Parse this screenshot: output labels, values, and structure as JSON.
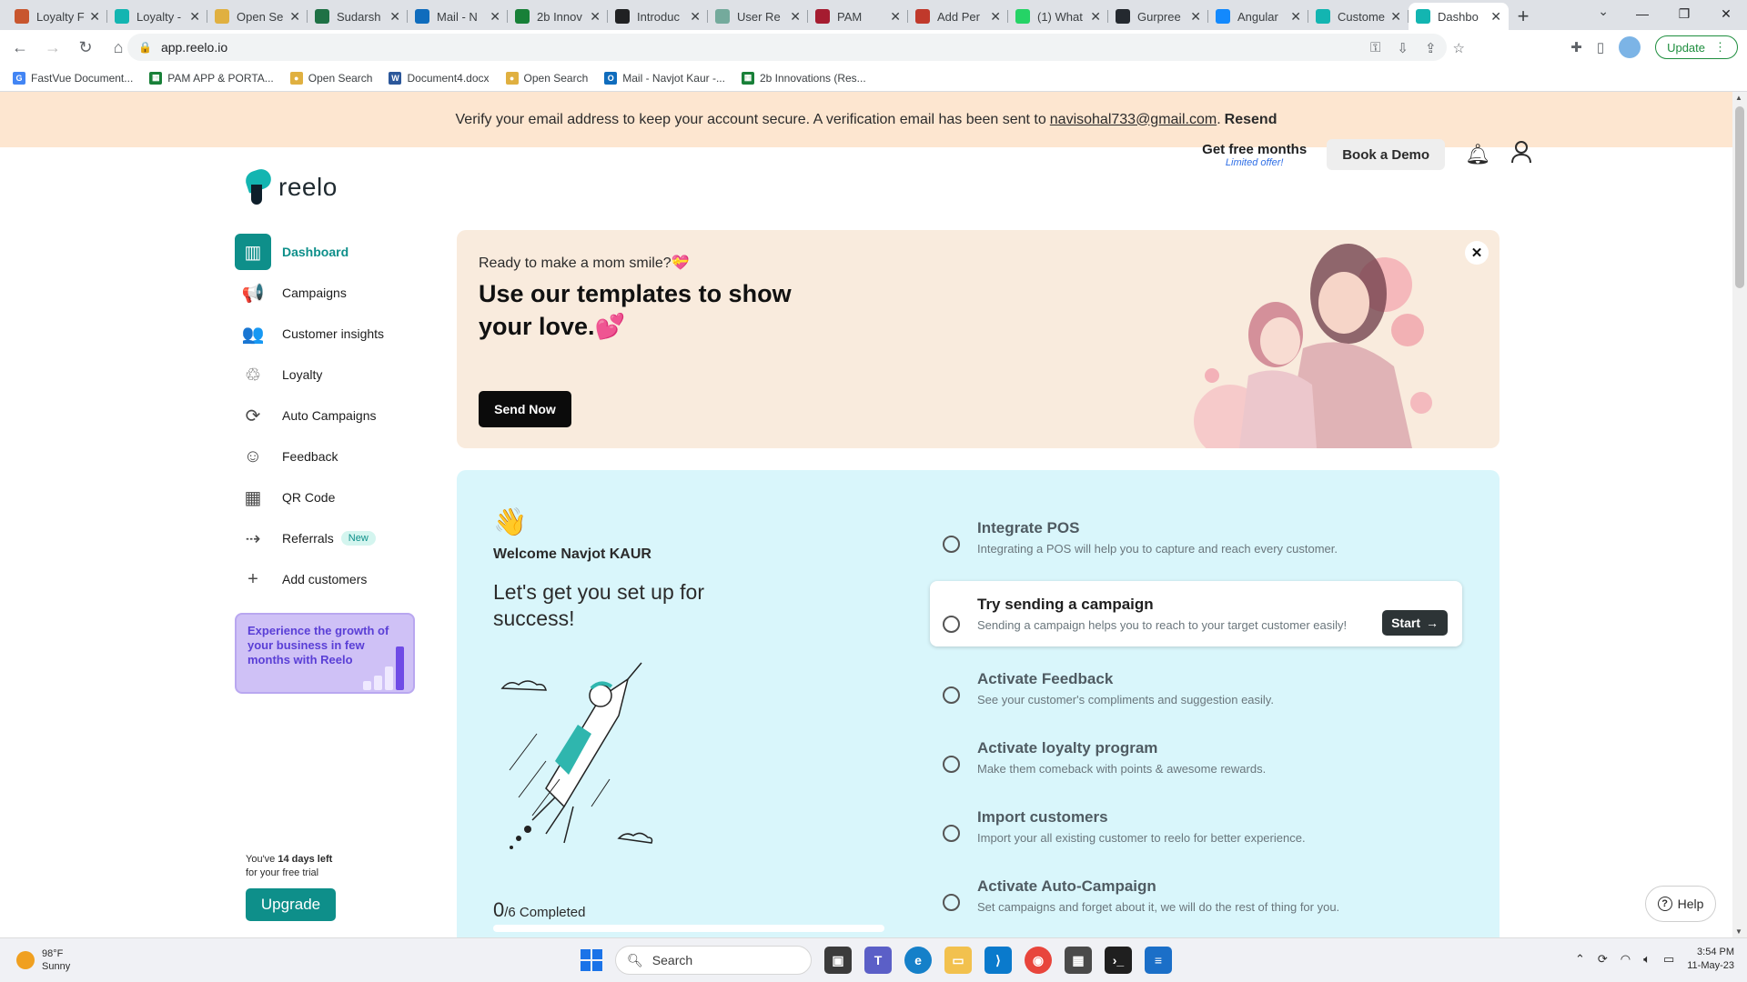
{
  "browser": {
    "tabs": [
      {
        "title": "Loyalty F",
        "icon": "tab-b-icon",
        "color": "#c8562e"
      },
      {
        "title": "Loyalty -",
        "icon": "reelo-icon",
        "color": "#13b5b1"
      },
      {
        "title": "Open Se",
        "icon": "opensearch-icon",
        "color": "#e0b040"
      },
      {
        "title": "Sudarsh",
        "icon": "excel-icon",
        "color": "#1e7145"
      },
      {
        "title": "Mail - N",
        "icon": "outlook-icon",
        "color": "#0f6cbd"
      },
      {
        "title": "2b Innov",
        "icon": "sheets-icon",
        "color": "#188038"
      },
      {
        "title": "Introduc",
        "icon": "openai-icon",
        "color": "#202123"
      },
      {
        "title": "User Re",
        "icon": "chatgpt-icon",
        "color": "#74aa9c"
      },
      {
        "title": "PAM",
        "icon": "pam-icon",
        "color": "#a51c30"
      },
      {
        "title": "Add Per",
        "icon": "p-icon",
        "color": "#c0392b"
      },
      {
        "title": "(1) What",
        "icon": "whatsapp-icon",
        "color": "#25d366"
      },
      {
        "title": "Gurpree",
        "icon": "github-icon",
        "color": "#24292f"
      },
      {
        "title": "Angular",
        "icon": "stackblitz-icon",
        "color": "#1389fd"
      },
      {
        "title": "Custome",
        "icon": "reelo-icon",
        "color": "#13b5b1"
      },
      {
        "title": "Dashbo",
        "icon": "reelo-icon",
        "color": "#13b5b1",
        "active": true
      }
    ],
    "new_tab": "+",
    "url": "app.reelo.io",
    "update_label": "Update",
    "bookmarks": [
      {
        "label": "FastVue Document...",
        "color": "#4285f4",
        "glyph": "G"
      },
      {
        "label": "PAM APP & PORTA...",
        "color": "#188038",
        "glyph": "▦"
      },
      {
        "label": "Open Search",
        "color": "#e0b040",
        "glyph": "●"
      },
      {
        "label": "Document4.docx",
        "color": "#2b579a",
        "glyph": "W"
      },
      {
        "label": "Open Search",
        "color": "#e0b040",
        "glyph": "●"
      },
      {
        "label": "Mail - Navjot Kaur -...",
        "color": "#0f6cbd",
        "glyph": "O"
      },
      {
        "label": "2b Innovations (Res...",
        "color": "#188038",
        "glyph": "▦"
      }
    ]
  },
  "banner": {
    "text": "Verify your email address to keep your account secure. A verification email has been sent to",
    "email": "navisohal733@gmail.com",
    "period": ".",
    "resend": "Resend"
  },
  "header": {
    "logo_text": "reelo",
    "free_months": "Get free months",
    "limited": "Limited offer!",
    "book_demo": "Book a Demo"
  },
  "sidebar": {
    "items": [
      {
        "label": "Dashboard",
        "icon": "dashboard-icon",
        "glyph": "▥",
        "active": true
      },
      {
        "label": "Campaigns",
        "icon": "megaphone-icon",
        "glyph": "📢"
      },
      {
        "label": "Customer insights",
        "icon": "users-icon",
        "glyph": "👥"
      },
      {
        "label": "Loyalty",
        "icon": "loyalty-icon",
        "glyph": "♲"
      },
      {
        "label": "Auto Campaigns",
        "icon": "refresh-icon",
        "glyph": "⟳"
      },
      {
        "label": "Feedback",
        "icon": "smiley-icon",
        "glyph": "☺"
      },
      {
        "label": "QR Code",
        "icon": "qr-code-icon",
        "glyph": "▦"
      },
      {
        "label": "Referrals",
        "icon": "referral-icon",
        "glyph": "⇢",
        "badge": "New"
      },
      {
        "label": "Add customers",
        "icon": "add-user-icon",
        "glyph": "+"
      }
    ],
    "promo": "Experience the growth of your business in few months with Reelo",
    "trial_prefix": "You've",
    "trial_days": "14 days left",
    "trial_suffix": "for your free trial",
    "upgrade": "Upgrade"
  },
  "hero": {
    "pretitle": "Ready to make a mom smile?💝",
    "title": "Use our templates to show your love.💕",
    "send_now": "Send Now"
  },
  "setup": {
    "welcome": "Welcome Navjot KAUR",
    "headline": "Let's get you set up for success!",
    "completed_count": "0",
    "completed_total": "/6 Completed",
    "progress": 0,
    "tasks": [
      {
        "title": "Integrate POS",
        "desc": "Integrating a POS will help you to capture and reach every customer."
      },
      {
        "title": "Try sending a campaign",
        "desc": "Sending a campaign helps you to reach to your target customer easily!",
        "highlight": true,
        "action": "Start"
      },
      {
        "title": "Activate Feedback",
        "desc": "See your customer's compliments and suggestion easily."
      },
      {
        "title": "Activate loyalty program",
        "desc": "Make them comeback with points & awesome rewards."
      },
      {
        "title": "Import customers",
        "desc": "Import your all existing customer to reelo for better experience."
      },
      {
        "title": "Activate Auto-Campaign",
        "desc": "Set campaigns and forget about it, we will do the rest of thing for you."
      }
    ]
  },
  "help": "Help",
  "taskbar": {
    "temp": "98°F",
    "condition": "Sunny",
    "search": "Search",
    "time": "3:54 PM",
    "date": "11-May-23"
  },
  "colors": {
    "brand": "#13b5b1",
    "accent": "#0e8f8a",
    "banner_bg": "#fde6d0",
    "hero_bg": "#f9ebdd",
    "setup_bg": "#d9f6fb"
  }
}
